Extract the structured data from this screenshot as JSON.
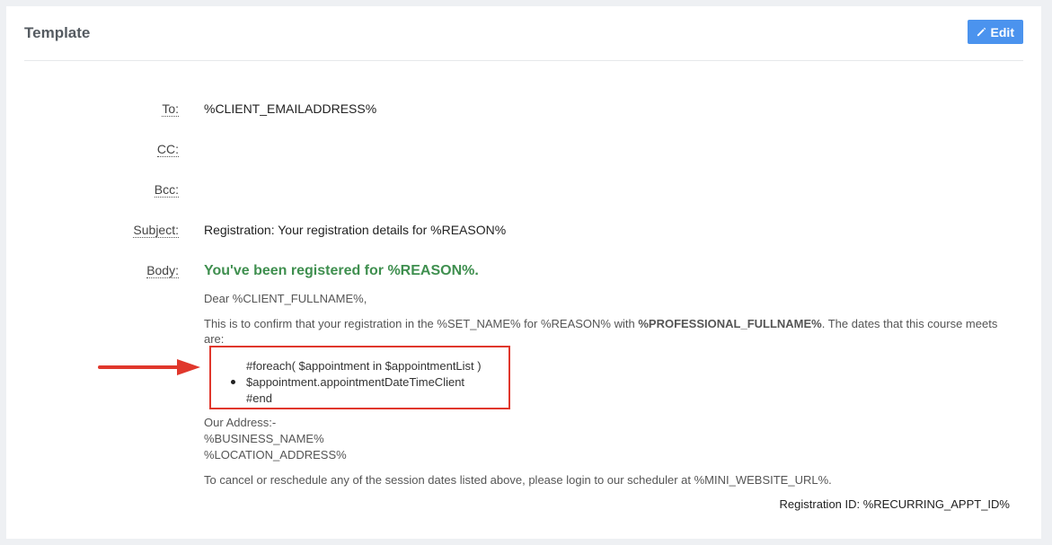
{
  "header": {
    "title": "Template",
    "edit_label": "Edit"
  },
  "fields": {
    "to_label": "To:",
    "to_value": "%CLIENT_EMAILADDRESS%",
    "cc_label": "CC:",
    "cc_value": "",
    "bcc_label": "Bcc:",
    "bcc_value": "",
    "subject_label": "Subject:",
    "subject_value": "Registration: Your registration details for %REASON%",
    "body_label": "Body:"
  },
  "body": {
    "heading": "You've been registered for %REASON%.",
    "greeting": "Dear %CLIENT_FULLNAME%,",
    "confirm_before": "This is to confirm that your registration in the %SET_NAME% for %REASON% with ",
    "confirm_bold": "%PROFESSIONAL_FULLNAME%",
    "confirm_after": ". The dates that this course meets are:",
    "loop_start": "#foreach( $appointment in $appointmentList )",
    "loop_item": "$appointment.appointmentDateTimeClient",
    "loop_end": "#end",
    "address_label": "Our Address:-",
    "business_name": "%BUSINESS_NAME%",
    "location_address": "%LOCATION_ADDRESS%",
    "cancel_text": "To cancel or reschedule any of the session dates listed above, please login to our scheduler at %MINI_WEBSITE_URL%.",
    "registration_id": "Registration ID: %RECURRING_APPT_ID%"
  },
  "colors": {
    "accent_button": "#4b93ee",
    "heading_green": "#3f8f4f",
    "annotation_red": "#e0372c"
  },
  "icons": {
    "edit": "pencil-icon",
    "annotation": "arrow-right-icon"
  }
}
